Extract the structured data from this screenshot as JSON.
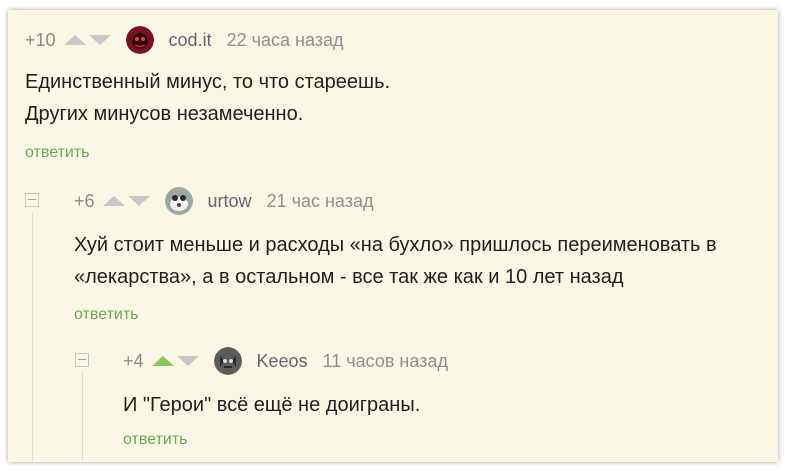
{
  "comments": [
    {
      "rating": "+10",
      "username": "cod.it",
      "time": "22 часа назад",
      "lines": [
        "Единственный минус, то что стареешь.",
        "Других минусов незамеченно."
      ],
      "reply": "ответить",
      "upvoted": false
    },
    {
      "rating": "+6",
      "username": "urtow",
      "time": "21 час назад",
      "lines": [
        "Хуй стоит меньше и расходы «на бухло» пришлось переименовать в",
        "«лекарства», а в остальном - все так же как и 10 лет назад"
      ],
      "reply": "ответить",
      "upvoted": false
    },
    {
      "rating": "+4",
      "username": "Keeos",
      "time": "11 часов назад",
      "lines": [
        "И \"Герои\" всё ещё не доиграны."
      ],
      "reply": "ответить",
      "upvoted": true
    }
  ],
  "colors": {
    "background": "#fbf7e6",
    "reply_link": "#6aa84f",
    "upvote_active": "#8ac858",
    "vote_inactive": "#c8c8c8"
  }
}
